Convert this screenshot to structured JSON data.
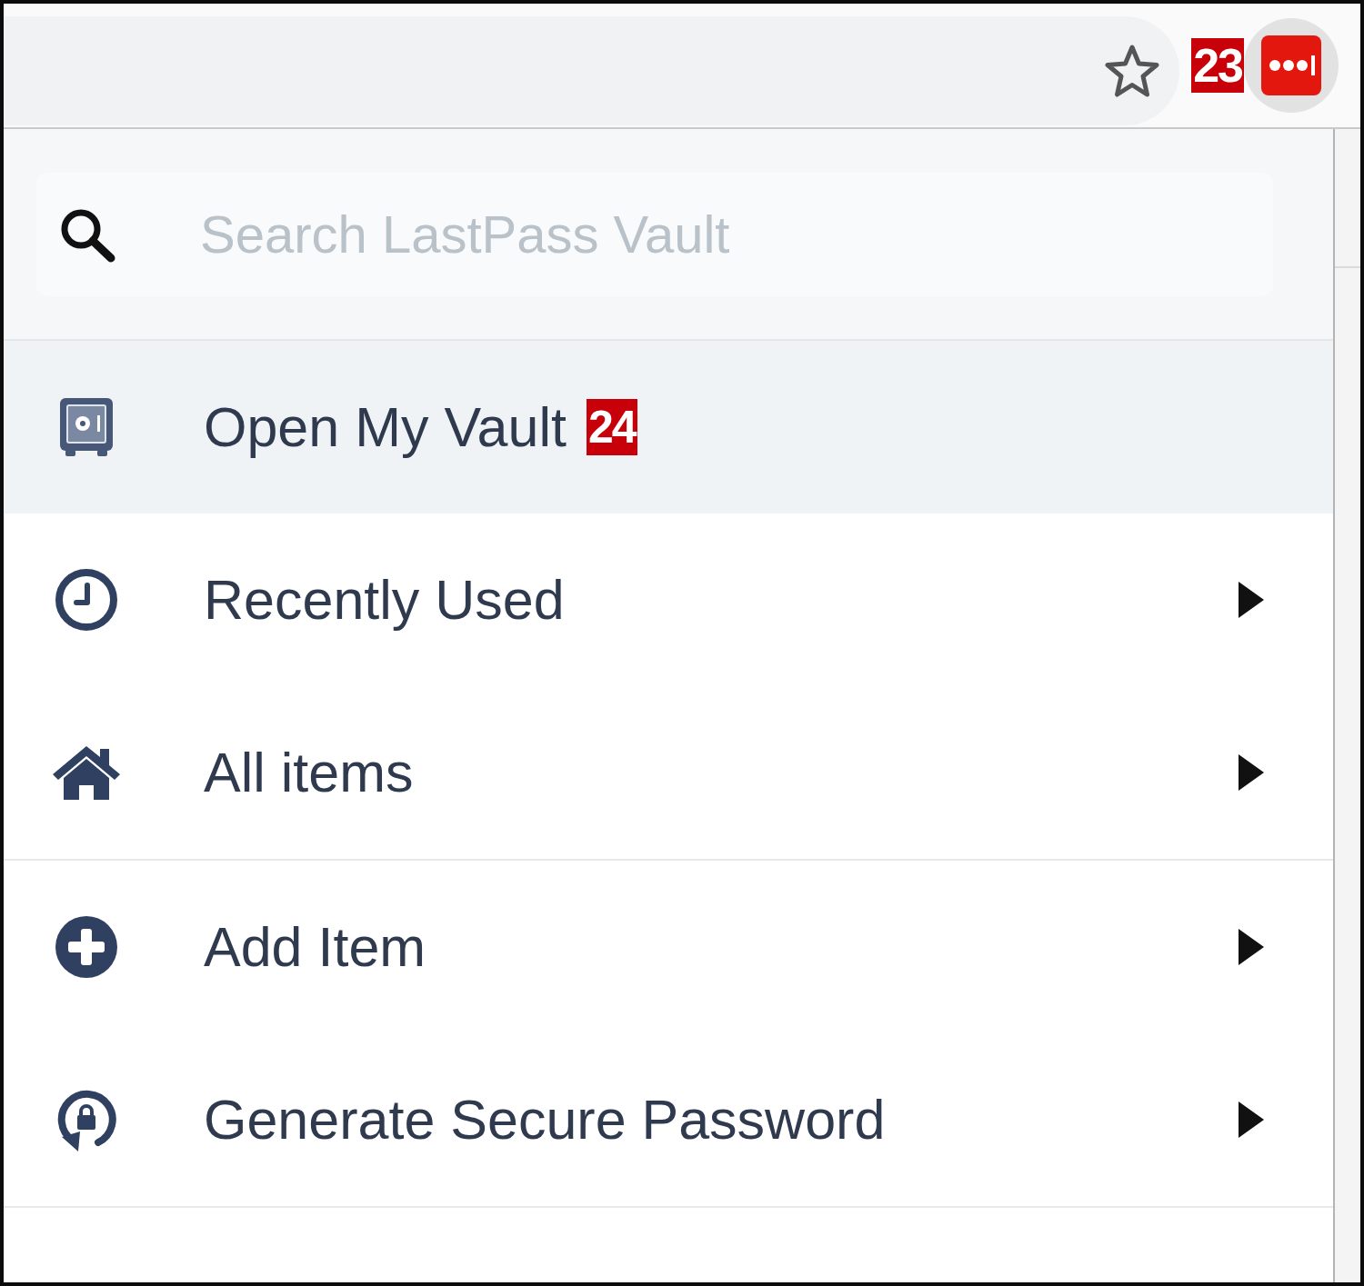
{
  "browser_toolbar": {
    "bookmarked": false,
    "extension_badge": "23",
    "extension_hovered": true
  },
  "search": {
    "placeholder": "Search LastPass Vault"
  },
  "menu": {
    "sections": [
      {
        "items": [
          {
            "label": "Open My Vault",
            "badge": "24",
            "highlighted": true,
            "submenu": false
          },
          {
            "label": "Recently Used",
            "highlighted": false,
            "submenu": true
          },
          {
            "label": "All items",
            "highlighted": false,
            "submenu": true
          }
        ]
      },
      {
        "items": [
          {
            "label": "Add Item",
            "highlighted": false,
            "submenu": true
          },
          {
            "label": "Generate Secure Password",
            "highlighted": false,
            "submenu": true
          }
        ]
      }
    ]
  }
}
